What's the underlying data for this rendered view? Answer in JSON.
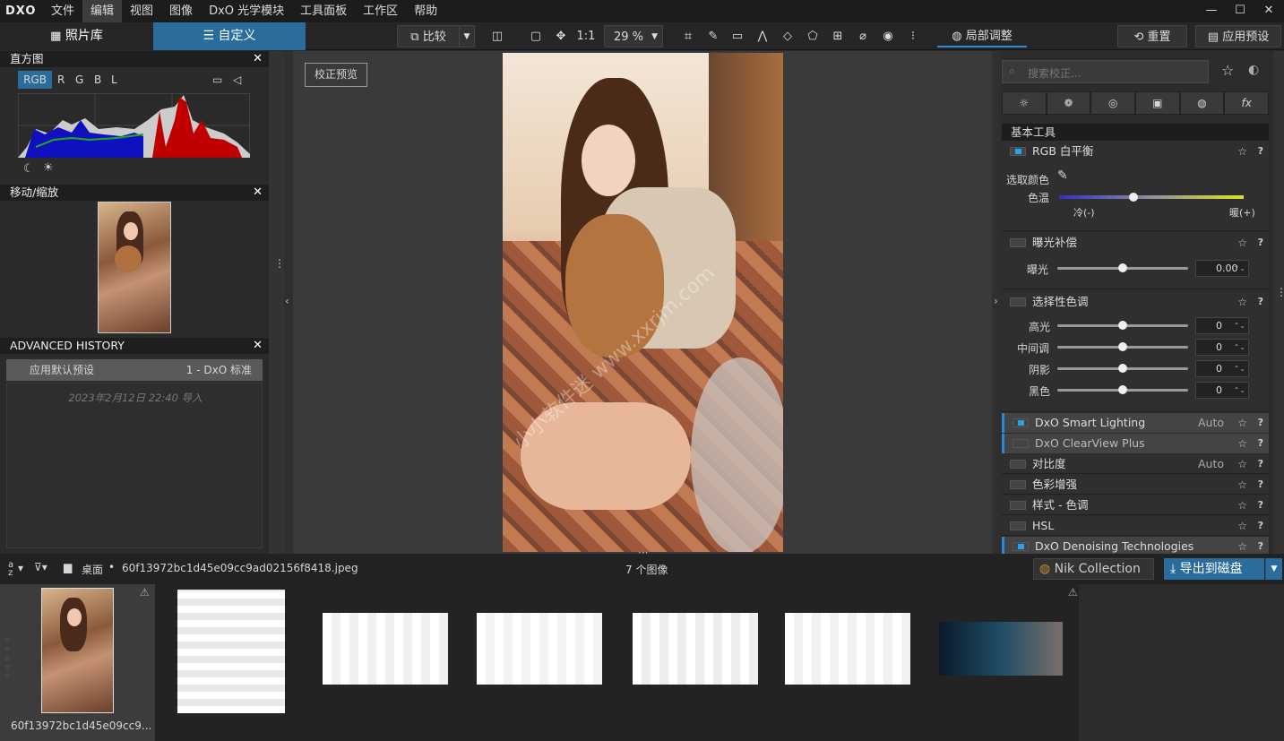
{
  "app": {
    "logo": "DXO",
    "menu": [
      "文件",
      "编辑",
      "视图",
      "图像",
      "DxO 光学模块",
      "工具面板",
      "工作区",
      "帮助"
    ],
    "window_controls": [
      "—",
      "☐",
      "✕"
    ]
  },
  "toolbar": {
    "tab_library": "照片库",
    "tab_customize": "自定义",
    "compare": "比较",
    "one_to_one": "1:1",
    "zoom": "29 %",
    "local_adjust": "局部调整",
    "reset": "重置",
    "apply_preset": "应用预设"
  },
  "left": {
    "histogram": {
      "title": "直方图",
      "channels": [
        "RGB",
        "R",
        "G",
        "B",
        "L"
      ],
      "active_channel": "RGB"
    },
    "navigator": {
      "title": "移动/缩放"
    },
    "history": {
      "title": "ADVANCED HISTORY",
      "item_action": "应用默认预设",
      "item_preset": "1 - DxO 标准",
      "import_line": "2023年2月12日 22:40 导入"
    }
  },
  "center": {
    "preview_button": "校正预览",
    "watermark": "小小软件迷 www.xxrjm.com"
  },
  "right": {
    "search_placeholder": "搜索校正...",
    "tabs_icons": [
      "sun-icon",
      "color-circles-icon",
      "detail-icon",
      "geometry-icon",
      "local-icon",
      "fx-icon"
    ],
    "section_title": "基本工具",
    "wb": {
      "name": "RGB 白平衡",
      "pick_color": "选取颜色",
      "temp_label": "色温",
      "cold": "冷(-)",
      "warm": "暖(+)"
    },
    "exposure": {
      "name": "曝光补偿",
      "label": "曝光",
      "value": "0.00"
    },
    "tone": {
      "name": "选择性色调",
      "rows": [
        {
          "label": "高光",
          "value": "0"
        },
        {
          "label": "中间调",
          "value": "0"
        },
        {
          "label": "阴影",
          "value": "0"
        },
        {
          "label": "黑色",
          "value": "0"
        }
      ]
    },
    "tools": [
      {
        "name": "DxO Smart Lighting",
        "auto": "Auto",
        "on": true,
        "highlight": true
      },
      {
        "name": "DxO ClearView Plus",
        "auto": "",
        "on": false,
        "highlight": true
      },
      {
        "name": "对比度",
        "auto": "Auto",
        "on": false,
        "highlight": false
      },
      {
        "name": "色彩增强",
        "auto": "",
        "on": false,
        "highlight": false
      },
      {
        "name": "样式 - 色调",
        "auto": "",
        "on": false,
        "highlight": false
      },
      {
        "name": "HSL",
        "auto": "",
        "on": false,
        "highlight": false
      },
      {
        "name": "DxO Denoising Technologies",
        "auto": "",
        "on": true,
        "highlight": true
      }
    ]
  },
  "bottom": {
    "sort_icon": "az-sort-icon",
    "folder": "桌面",
    "filename": "60f13972bc1d45e09cc9ad02156f8418.jpeg",
    "count": "7 个图像",
    "nik": "Nik Collection",
    "export": "导出到磁盘",
    "thumb_caption": "60f13972bc1d45e09cc9..."
  },
  "colors": {
    "accent": "#2a7bc0",
    "panel_bg": "#2b2b2b",
    "header_bg": "#1e1e1e",
    "menubar": "#1c1c1c"
  }
}
